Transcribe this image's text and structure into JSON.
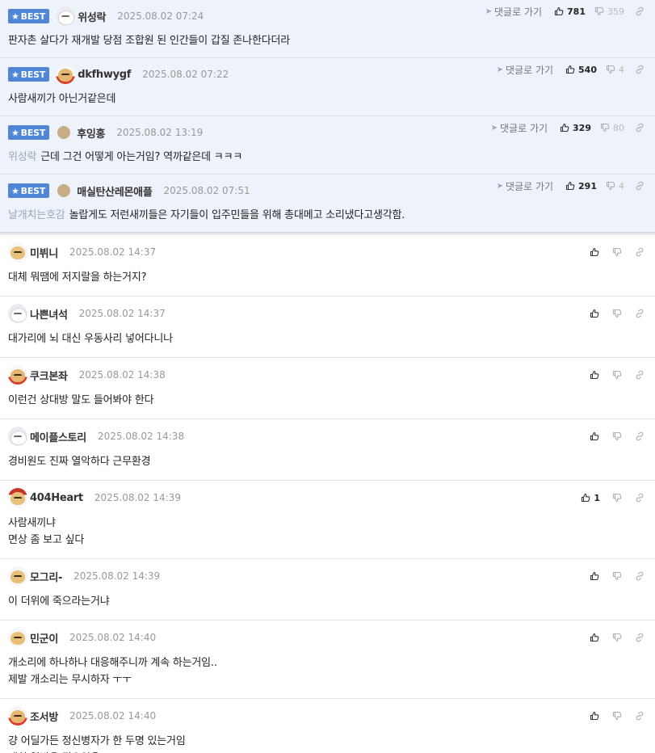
{
  "labels": {
    "best": "BEST",
    "reply": "댓글로 가기"
  },
  "best_comments": [
    {
      "avatar": "puppy-white-icon",
      "nick": "위성락",
      "date": "2025.08.02 07:24",
      "up": "781",
      "down": "359",
      "mention": "",
      "lines": [
        "판자촌 살다가 재개발 당점 조합원 된 인간들이 갑질 존나한다더라"
      ]
    },
    {
      "avatar": "puppy-red-icon",
      "nick": "dkfhwygf",
      "date": "2025.08.02 07:22",
      "up": "540",
      "down": "4",
      "mention": "",
      "lines": [
        "사람새끼가 아닌거같은데"
      ]
    },
    {
      "avatar": "dot-icon",
      "nick": "후잉홍",
      "date": "2025.08.02 13:19",
      "up": "329",
      "down": "80",
      "mention": "위성락",
      "lines": [
        "근데 그건 어떻게 아는거임? 역까같은데 ㅋㅋㅋ"
      ]
    },
    {
      "avatar": "dot-icon",
      "nick": "매실탄산레몬애플",
      "date": "2025.08.02 07:51",
      "up": "291",
      "down": "4",
      "mention": "날개치는호감",
      "lines": [
        "놀랍게도 저런새끼들은 자기들이 입주민들을 위해 총대메고 소리냈다고생각함."
      ]
    }
  ],
  "comments": [
    {
      "avatar": "puppy-icon",
      "nick": "미뷔니",
      "date": "2025.08.02 14:37",
      "up": "",
      "lines": [
        "대체 뭐땜에 저지랄을 하는거지?"
      ]
    },
    {
      "avatar": "puppy-white-icon",
      "nick": "나쁜녀석",
      "date": "2025.08.02 14:37",
      "up": "",
      "lines": [
        "대가리에 뇌 대신 우동사리 넣어다니나"
      ]
    },
    {
      "avatar": "puppy-red-icon",
      "nick": "쿠크본좌",
      "date": "2025.08.02 14:38",
      "up": "",
      "lines": [
        "이런건 상대방 말도 들어봐야 한다"
      ]
    },
    {
      "avatar": "puppy-white-icon",
      "nick": "메이플스토리",
      "date": "2025.08.02 14:38",
      "up": "",
      "lines": [
        "경비원도 진짜 열악하다 근무환경"
      ]
    },
    {
      "avatar": "puppy-hat-icon",
      "nick": "404Heart",
      "date": "2025.08.02 14:39",
      "up": "1",
      "lines": [
        "사람새끼냐",
        "면상 좀 보고 싶다"
      ]
    },
    {
      "avatar": "puppy-icon",
      "nick": "모그리-",
      "date": "2025.08.02 14:39",
      "up": "",
      "lines": [
        "이 더위에 죽으라는거냐"
      ]
    },
    {
      "avatar": "puppy-icon",
      "nick": "민군이",
      "date": "2025.08.02 14:40",
      "up": "",
      "lines": [
        "개소리에 하나하나 대응해주니까 계속 하는거임..",
        "제발 개소리는 무시하자 ㅜㅜ"
      ]
    },
    {
      "avatar": "puppy-red-icon",
      "nick": "조서방",
      "date": "2025.08.02 14:40",
      "up": "",
      "lines": [
        "걍 어딜가든 정신병자가 한 두명 있는거임",
        "괜히 열받을 필요없음 ㅋㅋ"
      ]
    }
  ]
}
